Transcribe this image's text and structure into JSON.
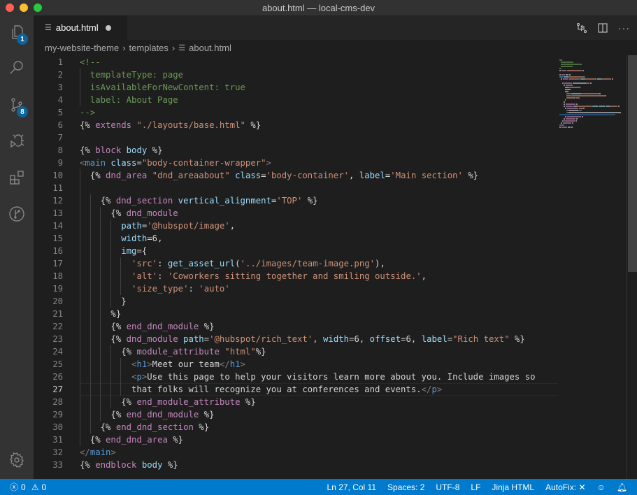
{
  "window": {
    "title": "about.html — local-cms-dev"
  },
  "activity_bar": {
    "explorer_badge": "1",
    "scm_badge": "8"
  },
  "tabs": [
    {
      "label": "about.html",
      "modified": true
    }
  ],
  "breadcrumb": [
    "my-website-theme",
    "templates",
    "about.html"
  ],
  "editor": {
    "current_line": 27,
    "lines": [
      {
        "n": "1",
        "tokens": [
          [
            "c-com",
            "<!--"
          ]
        ]
      },
      {
        "n": "2",
        "tokens": [
          [
            "c-com",
            "  templateType: page"
          ]
        ]
      },
      {
        "n": "3",
        "tokens": [
          [
            "c-com",
            "  isAvailableForNewContent: true"
          ]
        ]
      },
      {
        "n": "4",
        "tokens": [
          [
            "c-com",
            "  label: About Page"
          ]
        ]
      },
      {
        "n": "5",
        "tokens": [
          [
            "c-com",
            "-->"
          ]
        ]
      },
      {
        "n": "6",
        "tokens": [
          [
            "",
            "{% "
          ],
          [
            "c-kw",
            "extends"
          ],
          [
            "c-str",
            " \"./layouts/base.html\""
          ],
          [
            "",
            " %}"
          ]
        ]
      },
      {
        "n": "7",
        "tokens": []
      },
      {
        "n": "8",
        "tokens": [
          [
            "",
            "{% "
          ],
          [
            "c-kw",
            "block"
          ],
          [
            "c-attr",
            " body"
          ],
          [
            "",
            " %}"
          ]
        ]
      },
      {
        "n": "9",
        "tokens": [
          [
            "c-punc",
            "<"
          ],
          [
            "c-tag",
            "main"
          ],
          [
            "c-attr",
            " class"
          ],
          [
            "",
            "="
          ],
          [
            "c-str",
            "\"body-container-wrapper\""
          ],
          [
            "c-punc",
            ">"
          ]
        ]
      },
      {
        "n": "10",
        "tokens": [
          [
            "",
            "  {% "
          ],
          [
            "c-kw",
            "dnd_area"
          ],
          [
            "c-str",
            " \"dnd_areaabout\""
          ],
          [
            "c-attr",
            " class"
          ],
          [
            "",
            "="
          ],
          [
            "c-str",
            "'body-container'"
          ],
          [
            "",
            ", "
          ],
          [
            "c-attr",
            "label"
          ],
          [
            "",
            "="
          ],
          [
            "c-str",
            "'Main section'"
          ],
          [
            "",
            " %}"
          ]
        ]
      },
      {
        "n": "11",
        "tokens": []
      },
      {
        "n": "12",
        "tokens": [
          [
            "",
            "    {% "
          ],
          [
            "c-kw",
            "dnd_section"
          ],
          [
            "c-attr",
            " vertical_alignment"
          ],
          [
            "",
            "="
          ],
          [
            "c-str",
            "'TOP'"
          ],
          [
            "",
            " %}"
          ]
        ]
      },
      {
        "n": "13",
        "tokens": [
          [
            "",
            "      {% "
          ],
          [
            "c-kw",
            "dnd_module"
          ]
        ]
      },
      {
        "n": "14",
        "tokens": [
          [
            "",
            "        "
          ],
          [
            "c-attr",
            "path"
          ],
          [
            "",
            "="
          ],
          [
            "c-str",
            "'@hubspot/image'"
          ],
          [
            "",
            ","
          ]
        ]
      },
      {
        "n": "15",
        "tokens": [
          [
            "",
            "        "
          ],
          [
            "c-attr",
            "width"
          ],
          [
            "",
            "=6,"
          ]
        ]
      },
      {
        "n": "16",
        "tokens": [
          [
            "",
            "        "
          ],
          [
            "c-attr",
            "img"
          ],
          [
            "",
            "={"
          ]
        ]
      },
      {
        "n": "17",
        "tokens": [
          [
            "",
            "          "
          ],
          [
            "c-str",
            "'src'"
          ],
          [
            "",
            ": "
          ],
          [
            "c-fnb",
            "get_asset_url"
          ],
          [
            "",
            "("
          ],
          [
            "c-str",
            "'../images/team-image.png'"
          ],
          [
            "",
            "),"
          ]
        ]
      },
      {
        "n": "18",
        "tokens": [
          [
            "",
            "          "
          ],
          [
            "c-str",
            "'alt'"
          ],
          [
            "",
            ": "
          ],
          [
            "c-str",
            "'Coworkers sitting together and smiling outside.'"
          ],
          [
            "",
            ","
          ]
        ]
      },
      {
        "n": "19",
        "tokens": [
          [
            "",
            "          "
          ],
          [
            "c-str",
            "'size_type'"
          ],
          [
            "",
            ": "
          ],
          [
            "c-str",
            "'auto'"
          ]
        ]
      },
      {
        "n": "20",
        "tokens": [
          [
            "",
            "        }"
          ]
        ]
      },
      {
        "n": "21",
        "tokens": [
          [
            "",
            "      %}"
          ]
        ]
      },
      {
        "n": "22",
        "tokens": [
          [
            "",
            "      {% "
          ],
          [
            "c-kw",
            "end_dnd_module"
          ],
          [
            "",
            " %}"
          ]
        ]
      },
      {
        "n": "23",
        "tokens": [
          [
            "",
            "      {% "
          ],
          [
            "c-kw",
            "dnd_module"
          ],
          [
            "c-attr",
            " path"
          ],
          [
            "",
            "="
          ],
          [
            "c-str",
            "'@hubspot/rich_text'"
          ],
          [
            "",
            ", "
          ],
          [
            "c-attr",
            "width"
          ],
          [
            "",
            "=6, "
          ],
          [
            "c-attr",
            "offset"
          ],
          [
            "",
            "=6, "
          ],
          [
            "c-attr",
            "label"
          ],
          [
            "",
            "="
          ],
          [
            "c-str",
            "\"Rich text\""
          ],
          [
            "",
            " %}"
          ]
        ]
      },
      {
        "n": "24",
        "tokens": [
          [
            "",
            "        {% "
          ],
          [
            "c-kw",
            "module_attribute"
          ],
          [
            "c-str",
            " \"html\""
          ],
          [
            "",
            "%}"
          ]
        ]
      },
      {
        "n": "25",
        "tokens": [
          [
            "",
            "          "
          ],
          [
            "c-punc",
            "<"
          ],
          [
            "c-tag",
            "h1"
          ],
          [
            "c-punc",
            ">"
          ],
          [
            "",
            "Meet our team"
          ],
          [
            "c-punc",
            "</"
          ],
          [
            "c-tag",
            "h1"
          ],
          [
            "c-punc",
            ">"
          ]
        ]
      },
      {
        "n": "26",
        "tokens": [
          [
            "",
            "          "
          ],
          [
            "c-punc",
            "<"
          ],
          [
            "c-tag",
            "p"
          ],
          [
            "c-punc",
            ">"
          ],
          [
            "",
            "Use this page to help your visitors learn more about you. Include images so"
          ]
        ]
      },
      {
        "n": "27",
        "tokens": [
          [
            "",
            "          that folks will recognize you at conferences and events."
          ],
          [
            "c-punc",
            "</"
          ],
          [
            "c-tag",
            "p"
          ],
          [
            "c-punc",
            ">"
          ]
        ]
      },
      {
        "n": "28",
        "tokens": [
          [
            "",
            "        {% "
          ],
          [
            "c-kw",
            "end_module_attribute"
          ],
          [
            "",
            " %}"
          ]
        ]
      },
      {
        "n": "29",
        "tokens": [
          [
            "",
            "      {% "
          ],
          [
            "c-kw",
            "end_dnd_module"
          ],
          [
            "",
            " %}"
          ]
        ]
      },
      {
        "n": "30",
        "tokens": [
          [
            "",
            "    {% "
          ],
          [
            "c-kw",
            "end_dnd_section"
          ],
          [
            "",
            " %}"
          ]
        ]
      },
      {
        "n": "31",
        "tokens": [
          [
            "",
            "  {% "
          ],
          [
            "c-kw",
            "end_dnd_area"
          ],
          [
            "",
            " %}"
          ]
        ]
      },
      {
        "n": "32",
        "tokens": [
          [
            "c-punc",
            "</"
          ],
          [
            "c-tag",
            "main"
          ],
          [
            "c-punc",
            ">"
          ]
        ]
      },
      {
        "n": "33",
        "tokens": [
          [
            "",
            "{% "
          ],
          [
            "c-kw",
            "endblock"
          ],
          [
            "c-attr",
            " body"
          ],
          [
            "",
            " %}"
          ]
        ]
      }
    ]
  },
  "status_bar": {
    "errors": "0",
    "warnings": "0",
    "cursor": "Ln 27, Col 11",
    "spaces": "Spaces: 2",
    "encoding": "UTF-8",
    "eol": "LF",
    "language": "Jinja HTML",
    "autofix": "AutoFix: ✕"
  },
  "colors": {
    "accent": "#007acc",
    "badge": "#0e639c"
  }
}
